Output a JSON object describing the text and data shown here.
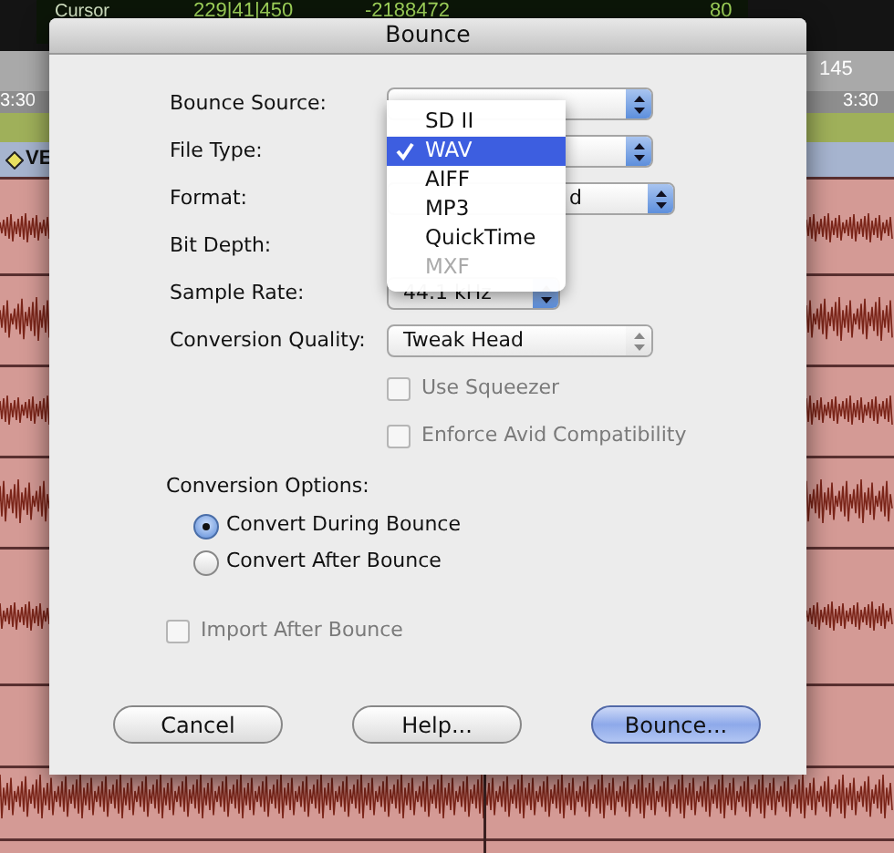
{
  "background": {
    "counter_label": "Cursor",
    "counter_value": "229|41|450",
    "offset_value": "-2188472",
    "zoom_value": "80",
    "ruler_bar": "145",
    "ruler_times": [
      "3:30",
      "3:30"
    ],
    "track_name": "VE"
  },
  "dialog": {
    "title": "Bounce",
    "fields": [
      {
        "label": "Bounce Source:",
        "kind": "popup",
        "highlighted": true
      },
      {
        "label": "File Type:",
        "kind": "popup",
        "highlighted": true
      },
      {
        "label": "Format:",
        "kind": "popup",
        "highlighted": true,
        "value": "d"
      },
      {
        "label": "Bit Depth:",
        "kind": "none"
      },
      {
        "label": "Sample Rate:",
        "kind": "popup",
        "highlighted": true,
        "value": "44.1 kHz"
      },
      {
        "label": "Conversion Quality:",
        "kind": "popup",
        "highlighted": false,
        "value": "Tweak Head"
      }
    ],
    "checkboxes": [
      {
        "label": "Use Squeezer",
        "checked": false,
        "disabled": true
      },
      {
        "label": "Enforce Avid Compatibility",
        "checked": false,
        "disabled": true
      }
    ],
    "conversion_options": {
      "title": "Conversion Options:",
      "options": [
        {
          "label": "Convert During Bounce",
          "selected": true
        },
        {
          "label": "Convert After Bounce",
          "selected": false
        }
      ]
    },
    "import_checkbox": {
      "label": "Import After Bounce",
      "checked": false,
      "disabled": true
    },
    "buttons": [
      {
        "label": "Cancel",
        "default": false
      },
      {
        "label": "Help...",
        "default": false
      },
      {
        "label": "Bounce...",
        "default": true
      }
    ],
    "file_type_menu": [
      {
        "label": "SD II",
        "selected": false,
        "disabled": false
      },
      {
        "label": "WAV",
        "selected": true,
        "disabled": false
      },
      {
        "label": "AIFF",
        "selected": false,
        "disabled": false
      },
      {
        "label": "MP3",
        "selected": false,
        "disabled": false
      },
      {
        "label": "QuickTime",
        "selected": false,
        "disabled": false
      },
      {
        "label": "MXF",
        "selected": false,
        "disabled": true
      }
    ]
  }
}
